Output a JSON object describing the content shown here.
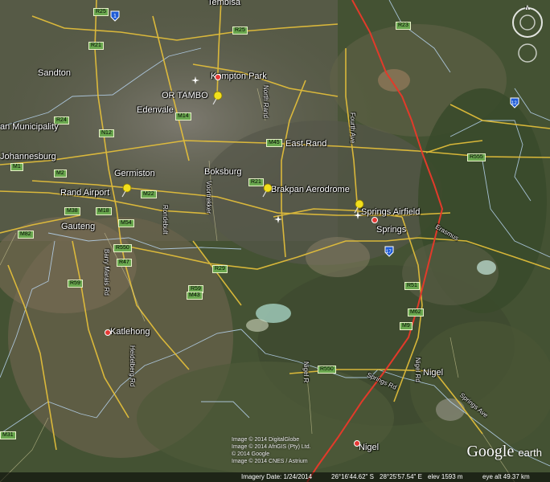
{
  "map": {
    "places": {
      "tembisa": "Tembisa",
      "sandton": "Sandton",
      "kempton_park": "Kempton Park",
      "or_tambo": "OR TAMBO",
      "edenvale": "Edenvale",
      "municipality": "an Municipality",
      "johannesburg": "Johannesburg",
      "germiston": "Germiston",
      "boksburg": "Boksburg",
      "rand_airport": "Rand Airport",
      "gauteng": "Gauteng",
      "brakpan_aerodrome": "Brakpan Aerodrome",
      "springs_airfield": "Springs Airfield",
      "springs": "Springs",
      "katlehong": "Katlehong",
      "nigel_town": "Nigel",
      "nigel_pin": "Nigel",
      "east_rand": "East Rand"
    },
    "roads": {
      "r25": "R25",
      "r21_top": "R21",
      "r21_mid": "R21",
      "r24": "R24",
      "r25b": "R25",
      "n12": "N12",
      "m1": "M1",
      "m2": "M2",
      "m18": "M18",
      "m54": "M54",
      "r59": "R59",
      "r59b": "R59",
      "m43": "M43",
      "r51": "R51",
      "m22": "M22",
      "r550": "R550",
      "r555": "R555",
      "r23": "R23",
      "r29": "R29",
      "m38": "M38",
      "m45": "M45",
      "m62": "M62",
      "m82": "M82",
      "m9": "M9",
      "m14": "M14",
      "r47": "R47",
      "m31": "M31",
      "r550b": "R550"
    },
    "shields": {
      "n1": "1",
      "n17": "17",
      "n12": "12"
    },
    "street_labels": {
      "springs_rd": "Springs Rd",
      "nigel_rd": "Nigel Rd",
      "heidelberg_rd": "Heidelberg Rd",
      "nigel_r": "Nigel R",
      "springs_ave": "Springs Ave",
      "fourth_ave": "Fourth Ave",
      "rondebult": "Rondebult",
      "voortrekker": "Voortrekker",
      "barry_marais": "Barry Marais Rd",
      "north_rand": "North Rand",
      "erasmus": "Erasmus"
    },
    "icons": {
      "pin": "pushpin-icon",
      "compass": "compass-icon",
      "airport": "airport-icon"
    },
    "colors": {
      "border": "#e23a2a",
      "road": "#e8c23a",
      "boundary": "#b9d6f2"
    }
  },
  "overlay": {
    "logo_google": "Google",
    "logo_earth": "earth",
    "credit1": "Image © 2014 DigitalGlobe",
    "credit2": "Image © 2014 AfriGIS (Pty) Ltd.",
    "credit3": "© 2014 Google",
    "credit4": "Image © 2014 CNES / Astrium"
  },
  "status": {
    "imagery_date": "Imagery Date: 1/24/2014",
    "lat": "26°16'44.62\" S",
    "lon": "28°25'57.54\" E",
    "elev": "elev 1593 m",
    "eye": "eye alt 49.37 km"
  }
}
